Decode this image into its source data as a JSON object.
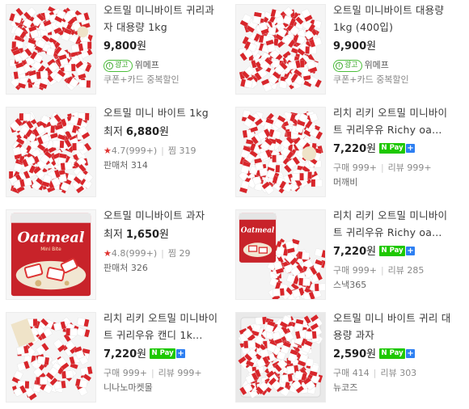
{
  "products": [
    {
      "title": "오트밀 미니바이트 귀리과자 대용량 1kg",
      "price_prefix": "",
      "price": "9,800",
      "won": "원",
      "ad_label": "광고",
      "ad_store": "위메프",
      "coupon": "쿠폰+카드 중복할인"
    },
    {
      "title": "오트밀 미니바이트 대용량 1kg (400입)",
      "price_prefix": "",
      "price": "9,900",
      "won": "원",
      "ad_label": "광고",
      "ad_store": "위메프",
      "coupon": "쿠폰+카드 중복할인"
    },
    {
      "title": "오트밀 미니 바이트 1kg",
      "price_prefix": "최저",
      "price": "6,880",
      "won": "원",
      "rating": "4.7(999+)",
      "zzim_label": "찜",
      "zzim": "319",
      "seller": "판매처 314"
    },
    {
      "title": "리치 리키 오트밀 미니바이트 귀리우유 Richy oa...",
      "price_prefix": "",
      "price": "7,220",
      "won": "원",
      "npay": "N Pay",
      "buy": "구매 999+",
      "review": "리뷰 999+",
      "seller": "머깨비"
    },
    {
      "title": "오트밀 미니바이트 과자",
      "price_prefix": "최저",
      "price": "1,650",
      "won": "원",
      "rating": "4.8(999+)",
      "zzim_label": "찜",
      "zzim": "29",
      "seller": "판매처 326"
    },
    {
      "title": "리치 리키 오트밀 미니바이트 귀리우유 Richy oa...",
      "price_prefix": "",
      "price": "7,220",
      "won": "원",
      "npay": "N Pay",
      "buy": "구매 999+",
      "review": "리뷰 285",
      "seller": "스낵365"
    },
    {
      "title": "리치 리키 오트밀 미니바이트 귀리우유 캔디 1k...",
      "price_prefix": "",
      "price": "7,220",
      "won": "원",
      "npay": "N Pay",
      "buy": "구매 999+",
      "review": "리뷰 999+",
      "seller": "니나노마켓몰"
    },
    {
      "title": "오트밀 미니 바이트 귀리 대용량 과자",
      "price_prefix": "",
      "price": "2,590",
      "won": "원",
      "npay": "N Pay",
      "buy": "구매 414",
      "review": "리뷰 303",
      "seller": "뉴코즈"
    }
  ],
  "package_text": {
    "brand": "Oatmeal",
    "sub": "Mini Bite"
  },
  "colors": {
    "npay_green": "#1ec800",
    "npay_blue": "#2d7ff2",
    "rating_star": "#e0322f",
    "ad_green": "#3aa62a",
    "candy_red": "#d8262b"
  },
  "icons": [
    "star-icon",
    "npay-logo-icon",
    "ad-info-icon"
  ]
}
